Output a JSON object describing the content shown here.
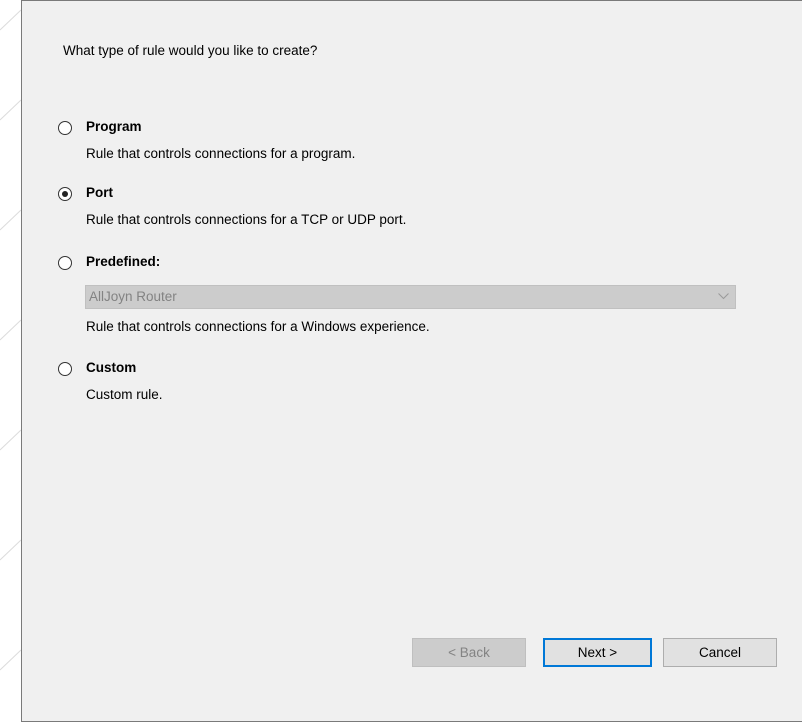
{
  "question": "What type of rule would you like to create?",
  "options": [
    {
      "label": "Program",
      "description": "Rule that controls connections for a program.",
      "selected": false
    },
    {
      "label": "Port",
      "description": "Rule that controls connections for a TCP or UDP port.",
      "selected": true
    },
    {
      "label": "Predefined:",
      "description": "Rule that controls connections for a Windows experience.",
      "selected": false
    },
    {
      "label": "Custom",
      "description": "Custom rule.",
      "selected": false
    }
  ],
  "predefined_select": {
    "value": "AllJoyn Router",
    "disabled": true
  },
  "buttons": {
    "back": "< Back",
    "next": "Next >",
    "cancel": "Cancel"
  },
  "colors": {
    "dialog_bg": "#f0f0f0",
    "default_button_border": "#0078d7",
    "disabled_text": "#838383"
  }
}
